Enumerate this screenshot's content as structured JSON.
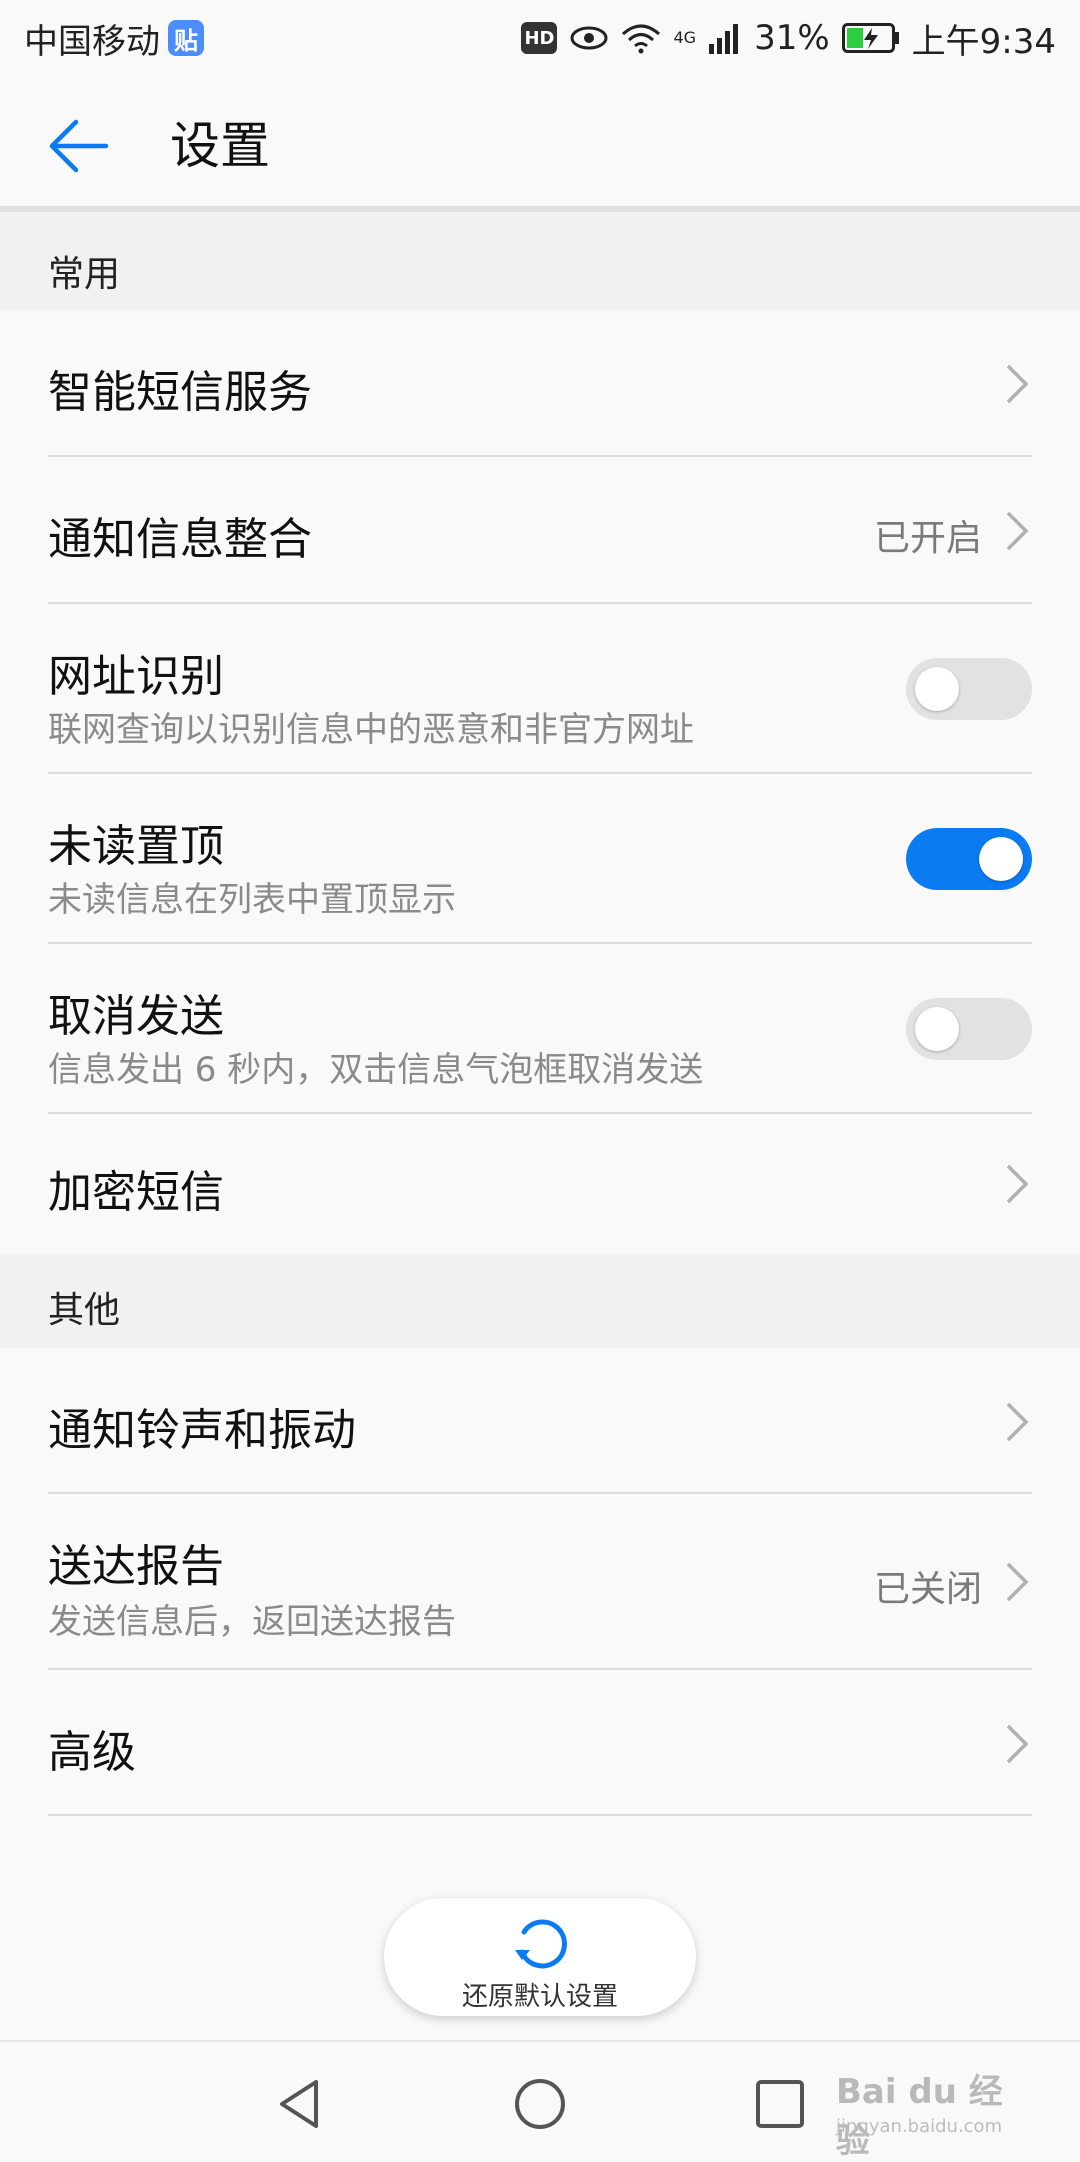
{
  "status_bar": {
    "carrier": "中国移动",
    "tie_badge": "贴",
    "hd": "HD",
    "network": "4G",
    "battery": "31%",
    "time": "上午9:34"
  },
  "header": {
    "title": "设置"
  },
  "sections": {
    "common": {
      "title": "常用",
      "items": [
        {
          "title": "智能短信服务"
        },
        {
          "title": "通知信息整合",
          "status": "已开启"
        },
        {
          "title": "网址识别",
          "subtitle": "联网查询以识别信息中的恶意和非官方网址",
          "toggle": false
        },
        {
          "title": "未读置顶",
          "subtitle": "未读信息在列表中置顶显示",
          "toggle": true
        },
        {
          "title": "取消发送",
          "subtitle": "信息发出 6 秒内，双击信息气泡框取消发送",
          "toggle": false
        },
        {
          "title": "加密短信"
        }
      ]
    },
    "other": {
      "title": "其他",
      "items": [
        {
          "title": "通知铃声和振动"
        },
        {
          "title": "送达报告",
          "subtitle": "发送信息后，返回送达报告",
          "status": "已关闭"
        },
        {
          "title": "高级"
        }
      ]
    }
  },
  "restore": {
    "label": "还原默认设置"
  },
  "watermark": {
    "text": "Bai du 经验",
    "sub": "jingyan.baidu.com"
  },
  "colors": {
    "accent": "#0a7bf3",
    "toggle_off": "#e2e2e2"
  },
  "icons": [
    "back-arrow-icon",
    "chevron-right-icon",
    "restore-icon",
    "nav-back-icon",
    "nav-home-icon",
    "nav-recents-icon"
  ]
}
